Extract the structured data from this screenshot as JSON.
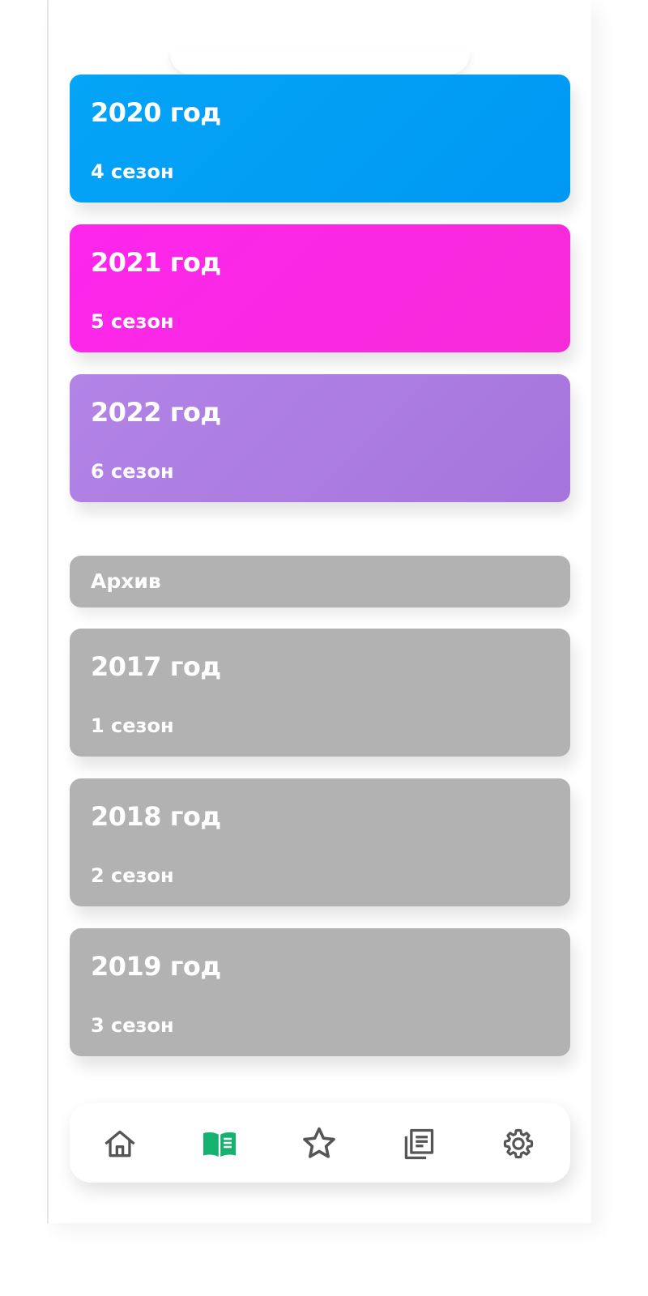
{
  "seasons_current": [
    {
      "title": "2020 год",
      "subtitle": "4 сезон",
      "color": "#029ff5"
    },
    {
      "title": "2021 год",
      "subtitle": "5 сезон",
      "color": "#fb29e6"
    },
    {
      "title": "2022 год",
      "subtitle": "6 сезон",
      "color": "#ad7ce3"
    }
  ],
  "archive": {
    "label": "Архив",
    "color": "#b2b2b2",
    "items": [
      {
        "title": "2017 год",
        "subtitle": "1 сезон"
      },
      {
        "title": "2018 год",
        "subtitle": "2 сезон"
      },
      {
        "title": "2019 год",
        "subtitle": "3 сезон"
      }
    ]
  },
  "tabbar": {
    "items": [
      {
        "icon": "home-icon",
        "active": false
      },
      {
        "icon": "book-icon",
        "active": true
      },
      {
        "icon": "star-icon",
        "active": false
      },
      {
        "icon": "news-icon",
        "active": false
      },
      {
        "icon": "gear-icon",
        "active": false
      }
    ],
    "active_color": "#14b26e",
    "inactive_color": "#555555"
  }
}
